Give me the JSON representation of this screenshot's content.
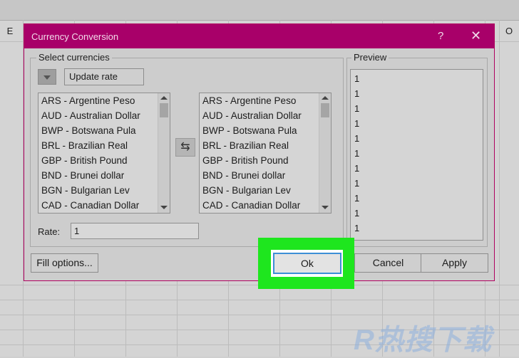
{
  "spreadsheet": {
    "col_headers": [
      "E",
      "O"
    ]
  },
  "dialog": {
    "title": "Currency Conversion",
    "help_glyph": "?",
    "close_glyph": "✕",
    "select_group_label": "Select currencies",
    "update_rate_label": "Update rate",
    "source_list": [
      "ARS - Argentine Peso",
      "AUD - Australian Dollar",
      "BWP - Botswana Pula",
      "BRL - Brazilian Real",
      "GBP - British Pound",
      "BND - Brunei dollar",
      "BGN - Bulgarian Lev",
      "CAD - Canadian Dollar"
    ],
    "target_list": [
      "ARS - Argentine Peso",
      "AUD - Australian Dollar",
      "BWP - Botswana Pula",
      "BRL - Brazilian Real",
      "GBP - British Pound",
      "BND - Brunei dollar",
      "BGN - Bulgarian Lev",
      "CAD - Canadian Dollar"
    ],
    "swap_glyph": "⇆",
    "rate_label": "Rate:",
    "rate_value": "1",
    "preview_label": "Preview",
    "preview_values": [
      "1",
      "1",
      "1",
      "1",
      "1",
      "1",
      "1",
      "1",
      "1",
      "1",
      "1"
    ],
    "fill_options_label": "Fill options...",
    "ok_label": "Ok",
    "cancel_label": "Cancel",
    "apply_label": "Apply"
  },
  "watermark": "R热搜下载",
  "colors": {
    "titlebar": "#a80069",
    "highlight": "#1ee61e",
    "focus_border": "#3c8fd6"
  }
}
